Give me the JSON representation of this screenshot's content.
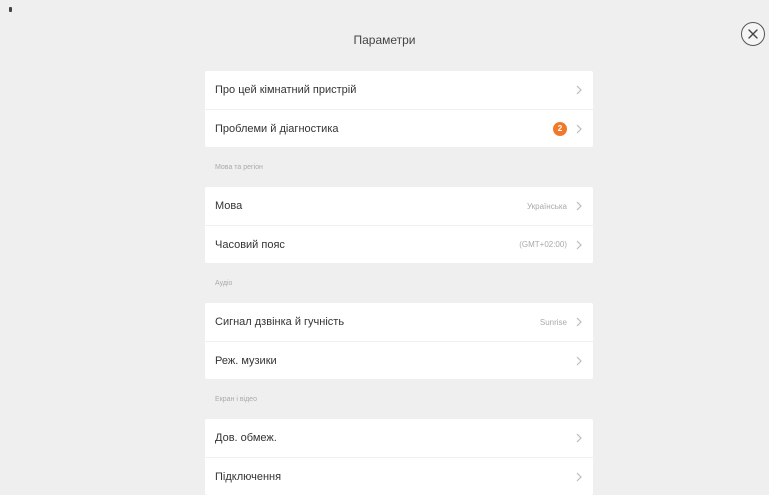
{
  "window": {
    "title": "Параметри"
  },
  "groups": [
    {
      "header": "",
      "items": [
        {
          "label": "Про цей кімнатний пристрій",
          "value": "",
          "badge": ""
        },
        {
          "label": "Проблеми й діагностика",
          "value": "",
          "badge": "2"
        }
      ]
    },
    {
      "header": "Мова та регіон",
      "items": [
        {
          "label": "Мова",
          "value": "Українська",
          "badge": ""
        },
        {
          "label": "Часовий пояс",
          "value": "(GMT+02:00)",
          "badge": ""
        }
      ]
    },
    {
      "header": "Аудіо",
      "items": [
        {
          "label": "Сигнал дзвінка й гучність",
          "value": "Sunrise",
          "badge": ""
        },
        {
          "label": "Реж. музики",
          "value": "",
          "badge": ""
        }
      ]
    },
    {
      "header": "Екран і відео",
      "items": [
        {
          "label": "Дов. обмеж.",
          "value": "",
          "badge": ""
        },
        {
          "label": "Підключення",
          "value": "",
          "badge": ""
        }
      ]
    }
  ],
  "colors": {
    "badge": "#f07a2a",
    "background": "#efefef",
    "card": "#ffffff"
  },
  "icons": {
    "close": "close-icon",
    "chevron": "chevron-right-icon"
  }
}
